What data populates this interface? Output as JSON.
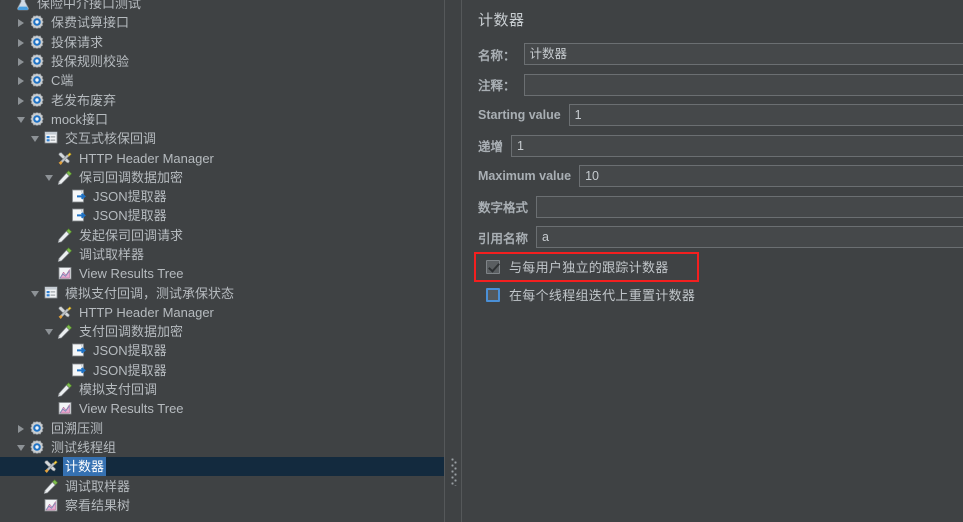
{
  "tree": {
    "name": "test-plan-tree",
    "rows": [
      {
        "label": "保险中介接口测试",
        "indent": 0,
        "toggle": "none",
        "icon": "flask-icon",
        "selected": false,
        "clipped": true
      },
      {
        "label": "保费试算接口",
        "indent": 1,
        "toggle": "closed",
        "icon": "controller-gear-icon",
        "selected": false
      },
      {
        "label": "投保请求",
        "indent": 1,
        "toggle": "closed",
        "icon": "controller-gear-icon",
        "selected": false
      },
      {
        "label": "投保规则校验",
        "indent": 1,
        "toggle": "closed",
        "icon": "controller-gear-icon",
        "selected": false
      },
      {
        "label": "C端",
        "indent": 1,
        "toggle": "closed",
        "icon": "controller-gear-icon",
        "selected": false
      },
      {
        "label": "老发布废弃",
        "indent": 1,
        "toggle": "closed",
        "icon": "controller-gear-icon",
        "selected": false
      },
      {
        "label": "mock接口",
        "indent": 1,
        "toggle": "open",
        "icon": "controller-gear-icon",
        "selected": false
      },
      {
        "label": "交互式核保回调",
        "indent": 2,
        "toggle": "open",
        "icon": "transaction-controller-icon",
        "selected": false
      },
      {
        "label": "HTTP Header Manager",
        "indent": 3,
        "toggle": "none",
        "icon": "config-wrench-icon",
        "selected": false
      },
      {
        "label": "保司回调数据加密",
        "indent": 3,
        "toggle": "open",
        "icon": "sampler-pipette-icon",
        "selected": false
      },
      {
        "label": "JSON提取器",
        "indent": 4,
        "toggle": "none",
        "icon": "post-processor-icon",
        "selected": false
      },
      {
        "label": "JSON提取器",
        "indent": 4,
        "toggle": "none",
        "icon": "post-processor-icon",
        "selected": false
      },
      {
        "label": "发起保司回调请求",
        "indent": 3,
        "toggle": "none",
        "icon": "sampler-pipette-icon",
        "selected": false
      },
      {
        "label": "调试取样器",
        "indent": 3,
        "toggle": "none",
        "icon": "sampler-pipette-icon",
        "selected": false
      },
      {
        "label": "View Results Tree",
        "indent": 3,
        "toggle": "none",
        "icon": "results-tree-icon",
        "selected": false
      },
      {
        "label": "模拟支付回调，测试承保状态",
        "indent": 2,
        "toggle": "open",
        "icon": "transaction-controller-icon",
        "selected": false
      },
      {
        "label": "HTTP Header Manager",
        "indent": 3,
        "toggle": "none",
        "icon": "config-wrench-icon",
        "selected": false
      },
      {
        "label": "支付回调数据加密",
        "indent": 3,
        "toggle": "open",
        "icon": "sampler-pipette-icon",
        "selected": false
      },
      {
        "label": "JSON提取器",
        "indent": 4,
        "toggle": "none",
        "icon": "post-processor-icon",
        "selected": false
      },
      {
        "label": "JSON提取器",
        "indent": 4,
        "toggle": "none",
        "icon": "post-processor-icon",
        "selected": false
      },
      {
        "label": "模拟支付回调",
        "indent": 3,
        "toggle": "none",
        "icon": "sampler-pipette-icon",
        "selected": false
      },
      {
        "label": "View Results Tree",
        "indent": 3,
        "toggle": "none",
        "icon": "results-tree-icon",
        "selected": false
      },
      {
        "label": "回溯压测",
        "indent": 1,
        "toggle": "closed",
        "icon": "controller-gear-icon",
        "selected": false
      },
      {
        "label": "测试线程组",
        "indent": 1,
        "toggle": "open",
        "icon": "controller-gear-icon",
        "selected": false
      },
      {
        "label": "计数器",
        "indent": 2,
        "toggle": "none",
        "icon": "config-wrench-icon",
        "selected": true
      },
      {
        "label": "调试取样器",
        "indent": 2,
        "toggle": "none",
        "icon": "sampler-pipette-icon",
        "selected": false
      },
      {
        "label": "察看结果树",
        "indent": 2,
        "toggle": "none",
        "icon": "results-tree-icon",
        "selected": false
      }
    ]
  },
  "form": {
    "title": "计数器",
    "fields": [
      {
        "label": "名称：",
        "value": "计数器",
        "name": "name-field"
      },
      {
        "label": "注释：",
        "value": "",
        "name": "comment-field"
      },
      {
        "label": "Starting value",
        "value": "1",
        "name": "starting-value-field"
      },
      {
        "label": "递增",
        "value": "1",
        "name": "increment-field"
      },
      {
        "label": "Maximum value",
        "value": "10",
        "name": "maximum-value-field"
      },
      {
        "label": "数字格式",
        "value": "",
        "name": "number-format-field"
      },
      {
        "label": "引用名称",
        "value": "a",
        "name": "reference-name-field"
      }
    ],
    "checkboxes": [
      {
        "label": "与每用户独立的跟踪计数器",
        "checked": true,
        "focused": false,
        "name": "track-counter-per-user-checkbox"
      },
      {
        "label": "在每个线程组迭代上重置计数器",
        "checked": false,
        "focused": true,
        "name": "reset-counter-each-iteration-checkbox"
      }
    ]
  },
  "annotation": {
    "color": "#f41f1f",
    "target": "与每用户独立的跟踪计数器"
  }
}
